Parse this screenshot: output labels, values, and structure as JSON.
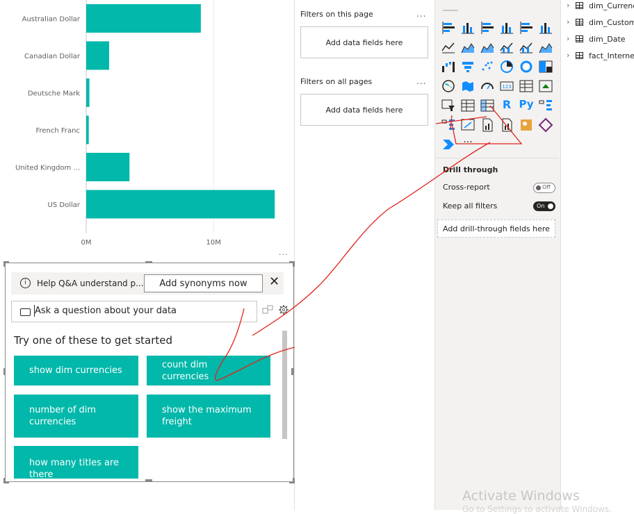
{
  "chart_data": {
    "type": "bar",
    "orientation": "horizontal",
    "categories": [
      "Australian Dollar",
      "Canadian Dollar",
      "Deutsche Mark",
      "French Franc",
      "United Kingdom ...",
      "US Dollar"
    ],
    "values": [
      9000000,
      1800000,
      250000,
      200000,
      3400000,
      14800000
    ],
    "xlim": [
      0,
      15500000
    ],
    "tick_labels": [
      "0M",
      "10M"
    ],
    "tick_values": [
      0,
      10000000
    ],
    "bar_color": "#01b8aa",
    "grid": true
  },
  "visual_more": "...",
  "filters": {
    "page_title": "Filters on this page",
    "page_more": "...",
    "page_placeholder": "Add data fields here",
    "all_title": "Filters on all pages",
    "all_more": "...",
    "all_placeholder": "Add data fields here"
  },
  "viz_pane": {
    "icons": [
      "stacked-bar-icon",
      "stacked-column-icon",
      "clustered-bar-icon",
      "clustered-column-icon",
      "100-bar-icon",
      "100-column-icon",
      "line-chart-icon",
      "area-chart-icon",
      "stacked-area-icon",
      "line-column-icon",
      "line-clustered-icon",
      "ribbon-chart-icon",
      "waterfall-icon",
      "funnel-icon",
      "scatter-icon",
      "pie-chart-icon",
      "donut-chart-icon",
      "treemap-icon",
      "map-icon",
      "filled-map-icon",
      "gauge-icon",
      "card-icon",
      "multirow-card-icon",
      "kpi-icon",
      "slicer-icon",
      "table-icon",
      "matrix-icon",
      "r-visual-icon",
      "python-visual-icon",
      "key-influencers-icon",
      "decomposition-tree-icon",
      "qa-visual-icon",
      "smart-narrative-icon",
      "paginated-report-icon",
      "arcgis-icon",
      "power-apps-icon",
      "power-automate-icon",
      "more-visuals-icon"
    ],
    "r_label": "R",
    "py_label": "Py",
    "more_label": "···",
    "drill_title": "Drill through",
    "cross_report": "Cross-report",
    "cross_toggle": "Off",
    "keep_filters": "Keep all filters",
    "keep_toggle": "On",
    "drill_placeholder": "Add drill-through fields here"
  },
  "fields": [
    "dim_Currenc",
    "dim_Custom",
    "dim_Date",
    "fact_Internet"
  ],
  "qa": {
    "help_text": "Help Q&A understand p...",
    "info_glyph": "i",
    "synonyms_button": "Add synonyms now",
    "close_glyph": "✕",
    "ask_placeholder": "Ask a question about your data",
    "try_text": "Try one of these to get started",
    "suggestions": [
      "show dim currencies",
      "count dim currencies",
      "number of dim currencies",
      "show the maximum freight",
      "how many titles are there"
    ],
    "accent": "#01b8aa"
  },
  "watermark": "Activate Windows",
  "watermark_sub": "Go to Settings to activate Windows."
}
